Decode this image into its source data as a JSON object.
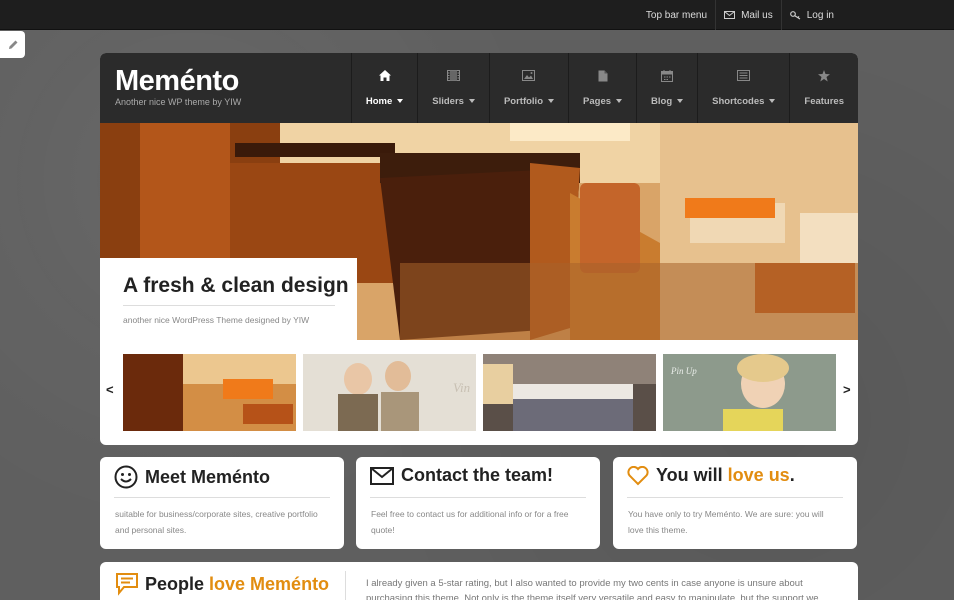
{
  "topbar": {
    "menu_label": "Top bar menu",
    "mail_label": "Mail us",
    "login_label": "Log in"
  },
  "site": {
    "logo": "Meménto",
    "tagline": "Another nice WP theme by YIW"
  },
  "nav": {
    "items": [
      {
        "label": "Home",
        "icon": "home-icon",
        "dropdown": true,
        "active": true
      },
      {
        "label": "Sliders",
        "icon": "film-icon",
        "dropdown": true
      },
      {
        "label": "Portfolio",
        "icon": "image-icon",
        "dropdown": true
      },
      {
        "label": "Pages",
        "icon": "document-icon",
        "dropdown": true
      },
      {
        "label": "Blog",
        "icon": "calendar-icon",
        "dropdown": true
      },
      {
        "label": "Shortcodes",
        "icon": "list-icon",
        "dropdown": true
      },
      {
        "label": "Features",
        "icon": "star-icon",
        "dropdown": false
      }
    ]
  },
  "hero": {
    "title": "A fresh & clean design",
    "subtitle": "another nice WordPress Theme designed by YIW"
  },
  "thumbs": {
    "prev": "<",
    "next": ">",
    "watermarks": [
      "Vin",
      "Pin Up"
    ]
  },
  "cards": [
    {
      "title": "Meet Meménto",
      "text": "suitable for business/corporate sites, creative portfolio and personal sites."
    },
    {
      "title": "Contact the team!",
      "text": "Feel free to contact us for additional info or for a free quote!"
    },
    {
      "title_a": "You will ",
      "title_b": "love us",
      "title_c": ".",
      "text": "You have only to try Meménto. We are sure: you will love this theme."
    }
  ],
  "testimonials": {
    "title_a": "People ",
    "title_b": "love Meménto",
    "text": "I already given a 5-star rating, but I also wanted to provide my two cents in case anyone is unsure about purchasing this theme. Not only is the theme itself very versatile and easy to manipulate, but the support we"
  },
  "colors": {
    "accent": "#e28d10",
    "header_bg": "#2b2b2b",
    "topbar_bg": "#1e1e1e"
  }
}
